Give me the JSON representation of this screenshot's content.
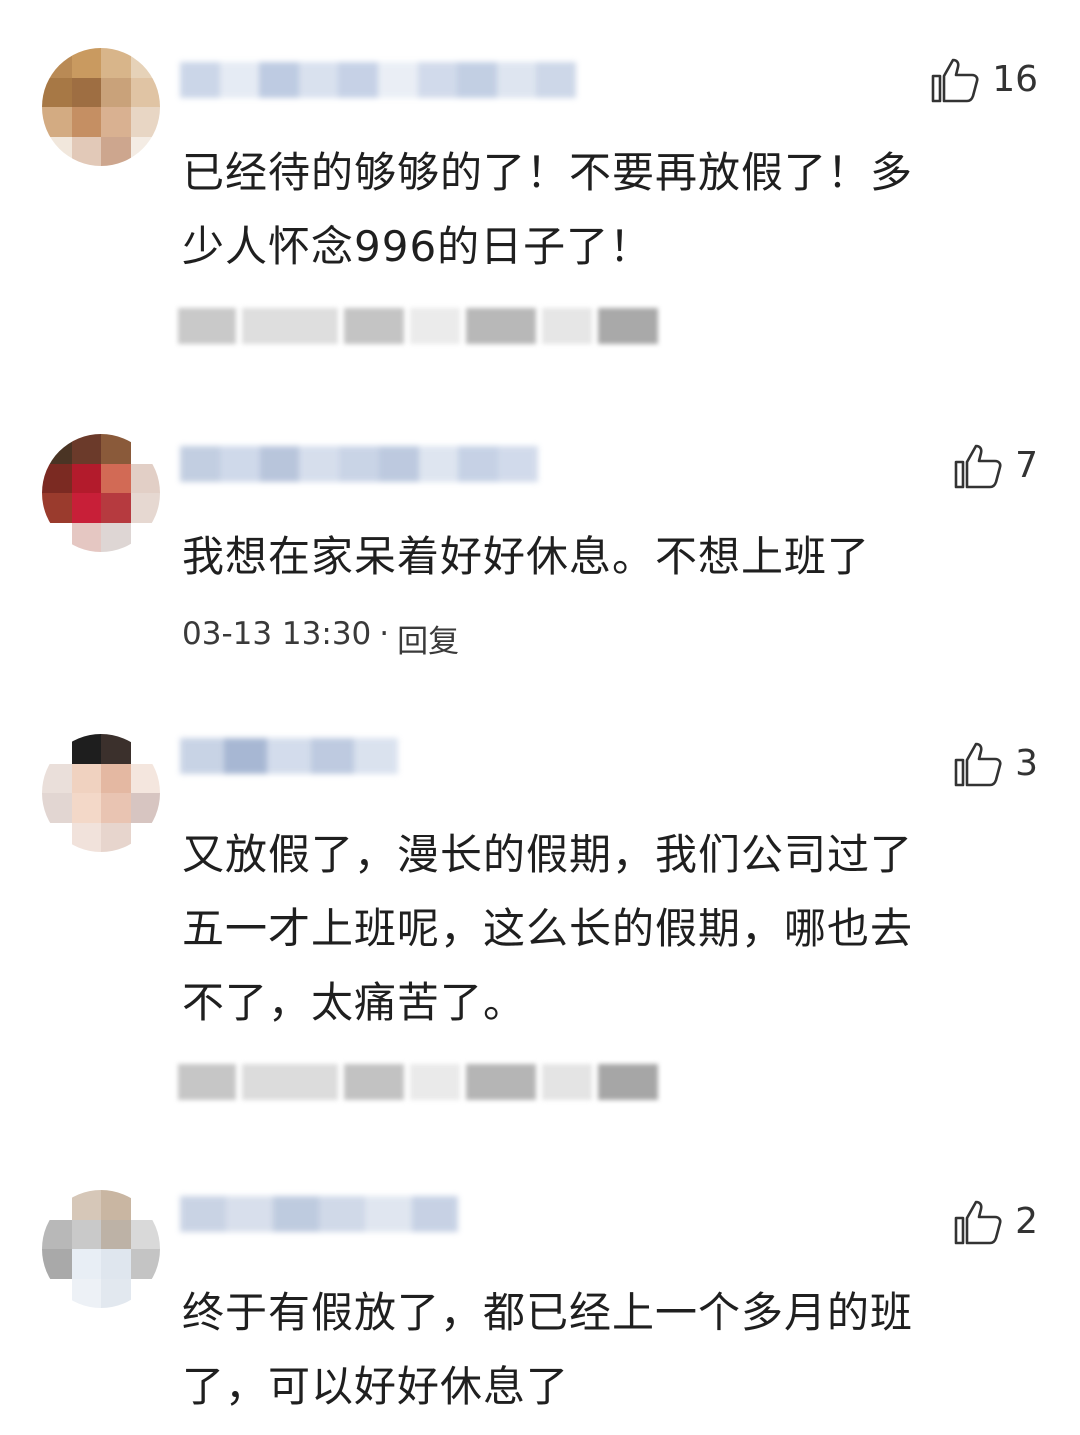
{
  "comments": [
    {
      "likes": "16",
      "text_lines": [
        "已经待的够够的了！不要再放假了！多",
        "少人怀念996的日子了！"
      ],
      "colors": {
        "avatar": [
          "#b98a55",
          "#c99a60",
          "#d8b58a",
          "#e6d2b8"
        ],
        "name": [
          "#c6d2e6",
          "#b7c6df",
          "#d5deed",
          "#c0cde4"
        ]
      }
    },
    {
      "likes": "7",
      "text_lines": [
        "我想在家呆着好好休息。不想上班了"
      ],
      "time": "03-13 13:30",
      "separator": "·",
      "reply": "回复",
      "colors": {
        "avatar": [
          "#6b3a2a",
          "#b31b2c",
          "#e2cfc6",
          "#8a5a3a"
        ],
        "name": [
          "#bcc9de",
          "#cad5e8",
          "#b1bfd8",
          "#d2dbeb"
        ]
      }
    },
    {
      "likes": "3",
      "text_lines": [
        "又放假了，漫长的假期，我们公司过了",
        "五一才上班呢，这么长的假期，哪也去",
        "不了，太痛苦了。"
      ],
      "colors": {
        "avatar": [
          "#f0d2c0",
          "#e4b8a2",
          "#d7c5c1",
          "#1e1e1e"
        ],
        "name": [
          "#c3cfe3",
          "#9eb0cf",
          "#cfd9ea",
          "#b7c5dd"
        ]
      }
    },
    {
      "likes": "2",
      "text_lines": [
        "终于有假放了，都已经上一个多月的班",
        "了，可以好好休息了"
      ],
      "colors": {
        "avatar": [
          "#c9c9c9",
          "#d6c7b8",
          "#a9a9a9",
          "#e8eef5"
        ],
        "name": [
          "#c4cfe2",
          "#d4dcea",
          "#b8c6dc",
          "#cbd5e6"
        ]
      }
    }
  ]
}
